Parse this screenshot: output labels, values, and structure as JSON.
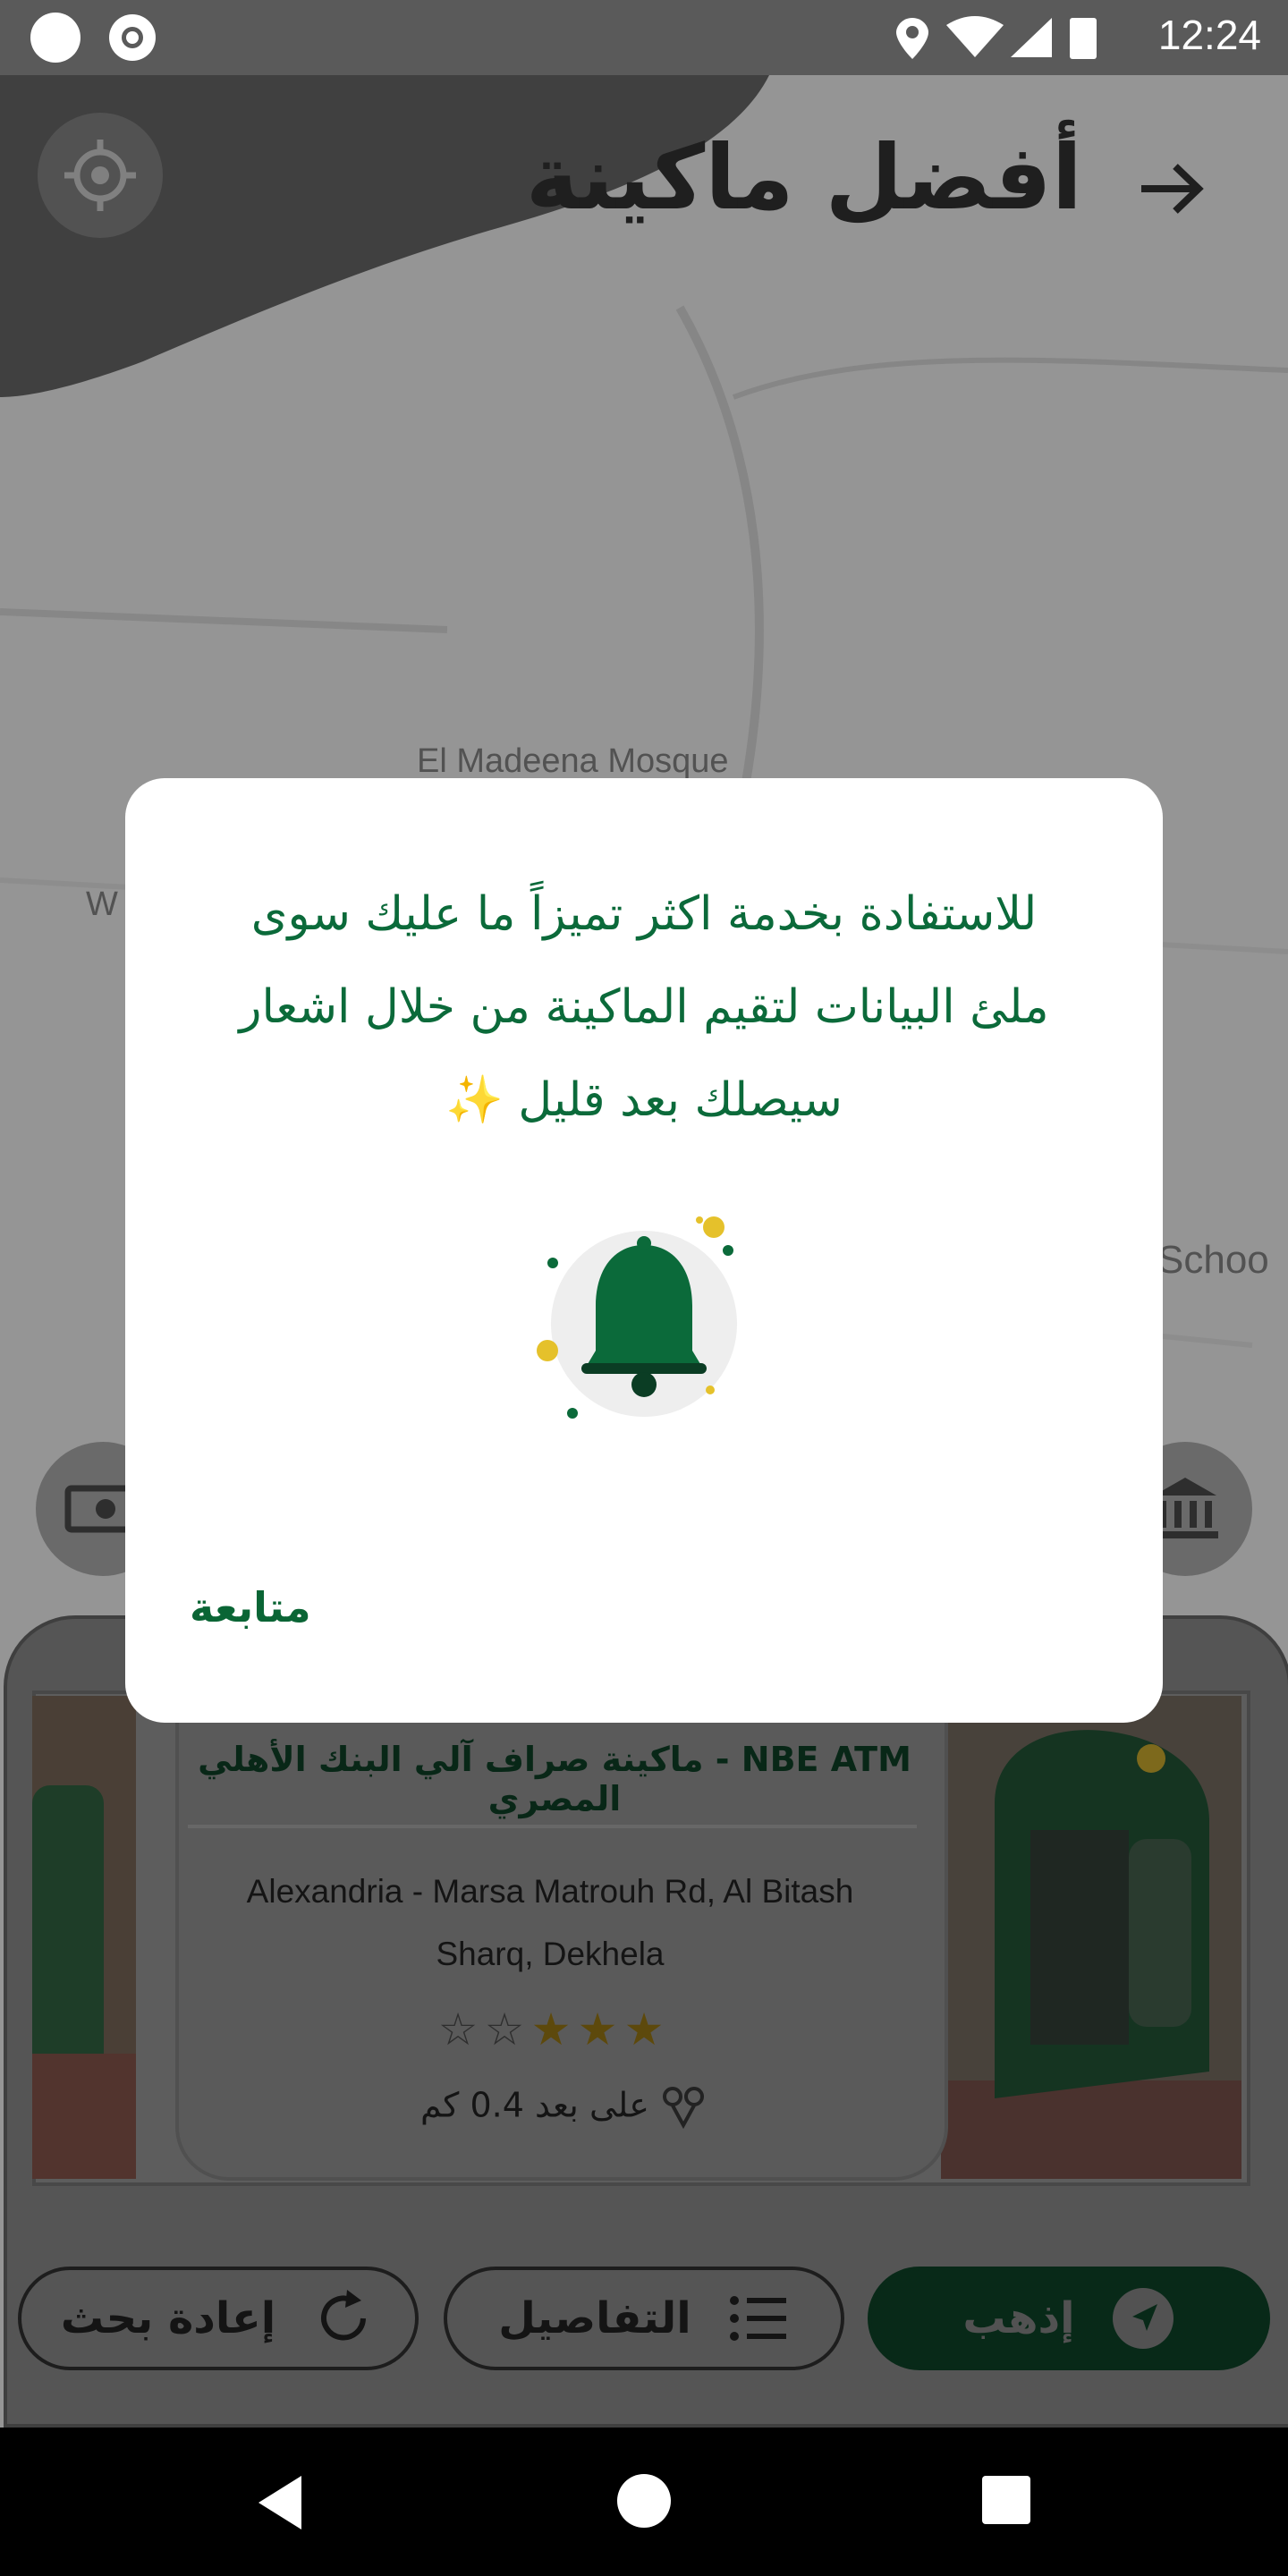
{
  "status_bar": {
    "time": "12:24"
  },
  "header": {
    "title": "أفضل ماكينة"
  },
  "map": {
    "labels": [
      "El Madeena Mosque",
      "Schoo",
      "W"
    ]
  },
  "atm_card": {
    "name": "NBE ATM - ماكينة صراف آلي البنك الأهلي المصري",
    "address": "Alexandria - Marsa Matrouh Rd, Al Bitash Sharq, Dekhela",
    "rating": 3,
    "rating_max": 5,
    "distance_prefix": "على بعد",
    "distance_value": "0.4",
    "distance_unit": "كم"
  },
  "actions": {
    "go_label": "إذهب",
    "details_label": "التفاصيل",
    "research_label": "إعادة بحث"
  },
  "dialog": {
    "message_line1": "للاستفادة بخدمة اكثر تميزاً ما عليك سوى",
    "message_line2": "ملئ البيانات لتقيم الماكينة من خلال اشعار",
    "message_line3": "سيصلك بعد قليل",
    "sparkle": "✨",
    "continue_label": "متابعة"
  },
  "colors": {
    "brand_green": "#0b6a3a",
    "dark_green": "#0d3d24",
    "star_gold": "#d4a514"
  },
  "icons": {
    "bell": "bell-icon",
    "navigate": "navigation-arrow-icon",
    "list": "list-icon",
    "refresh": "refresh-icon"
  }
}
